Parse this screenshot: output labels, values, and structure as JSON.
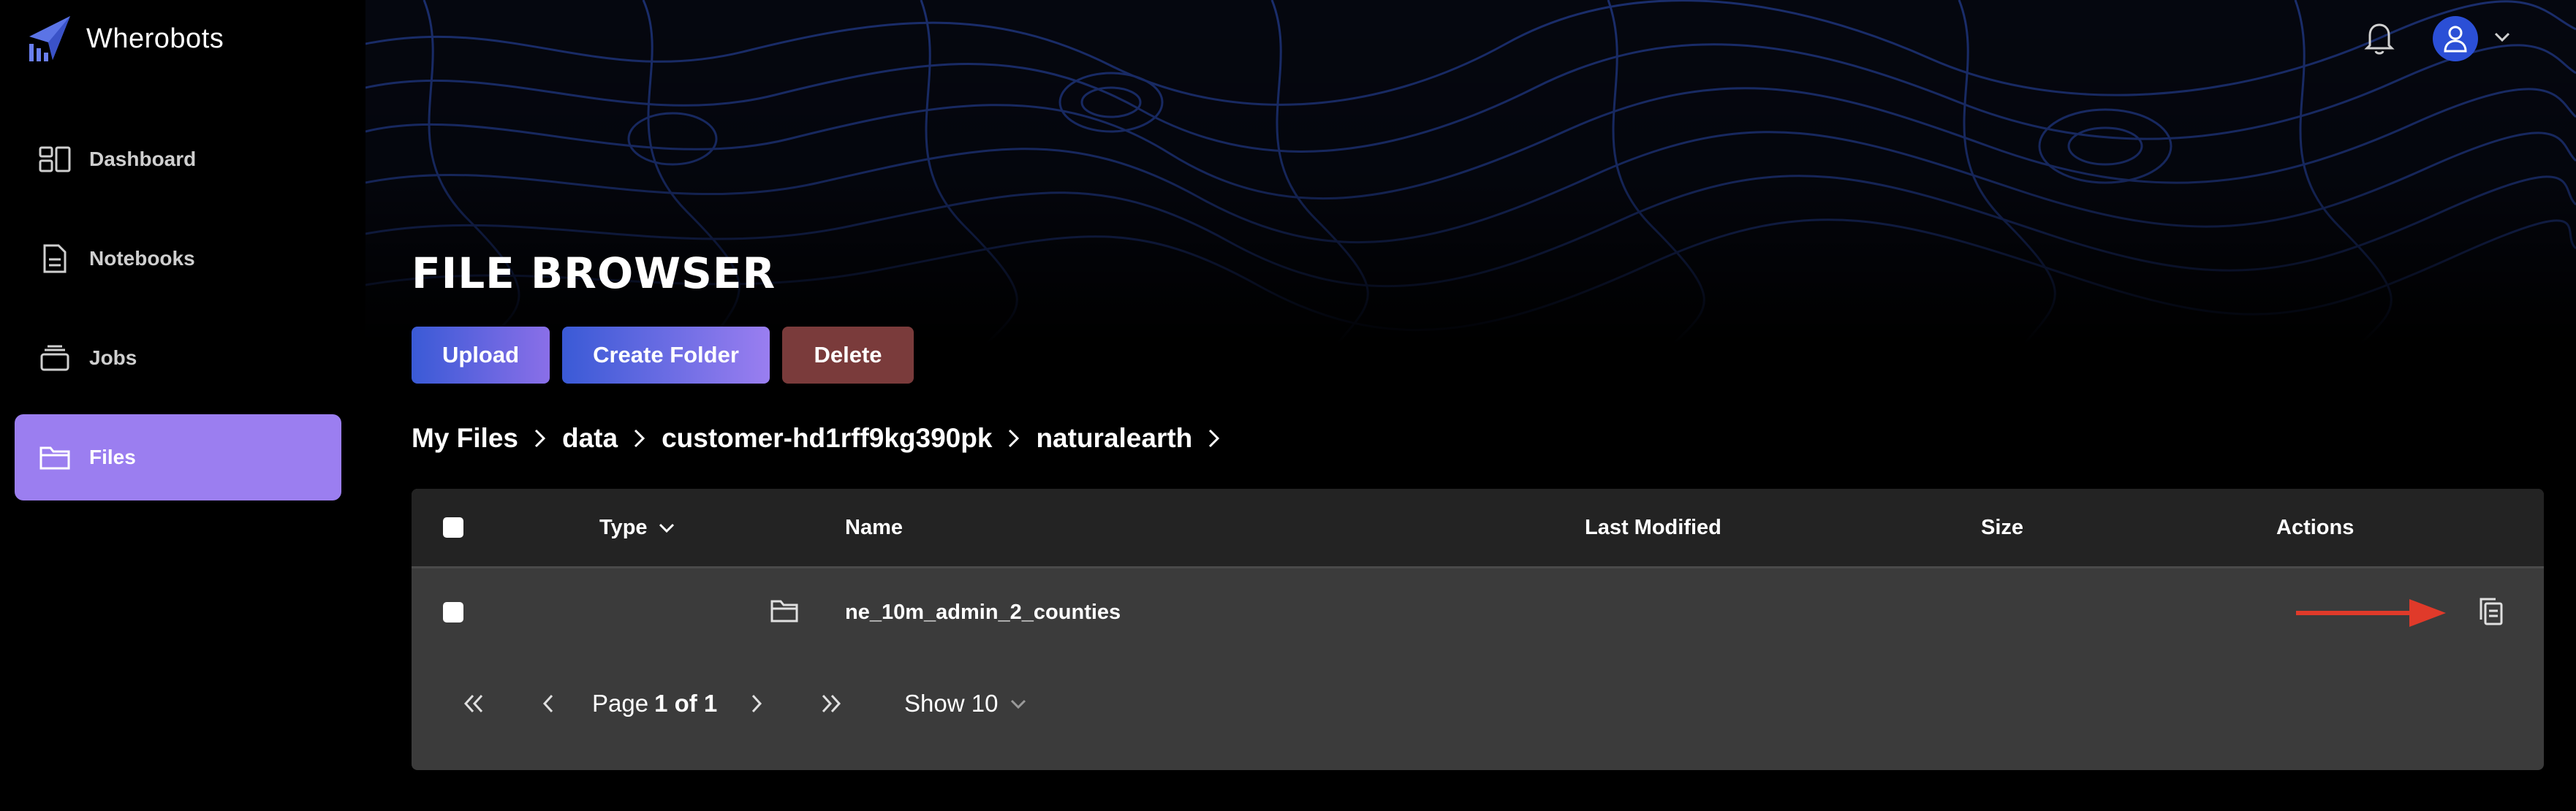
{
  "app": {
    "name": "Wherobots"
  },
  "sidebar": {
    "items": [
      {
        "label": "Dashboard",
        "icon": "dashboard-icon"
      },
      {
        "label": "Notebooks",
        "icon": "notebook-icon"
      },
      {
        "label": "Jobs",
        "icon": "jobs-icon"
      },
      {
        "label": "Files",
        "icon": "folder-icon",
        "active": true
      }
    ]
  },
  "header": {
    "notification_icon": "bell-icon",
    "avatar_icon": "user-icon"
  },
  "page": {
    "title": "FILE BROWSER"
  },
  "toolbar": {
    "upload_label": "Upload",
    "create_folder_label": "Create Folder",
    "delete_label": "Delete"
  },
  "breadcrumb": [
    "My Files",
    "data",
    "customer-hd1rff9kg390pk",
    "naturalearth"
  ],
  "table": {
    "columns": [
      "Type",
      "Name",
      "Last Modified",
      "Size",
      "Actions"
    ],
    "rows": [
      {
        "type_icon": "folder-icon",
        "name": "ne_10m_admin_2_counties",
        "last_modified": "",
        "size": "",
        "action_icon": "copy-icon"
      }
    ]
  },
  "pagination": {
    "page_prefix": "Page",
    "page_current_of_total": "1 of 1",
    "show_label": "Show 10"
  },
  "colors": {
    "accent": "#9b7ef0",
    "upload_bg": "#3a5ad6",
    "delete_bg": "#7a3b3b",
    "annotation_arrow": "#e03a2a"
  }
}
